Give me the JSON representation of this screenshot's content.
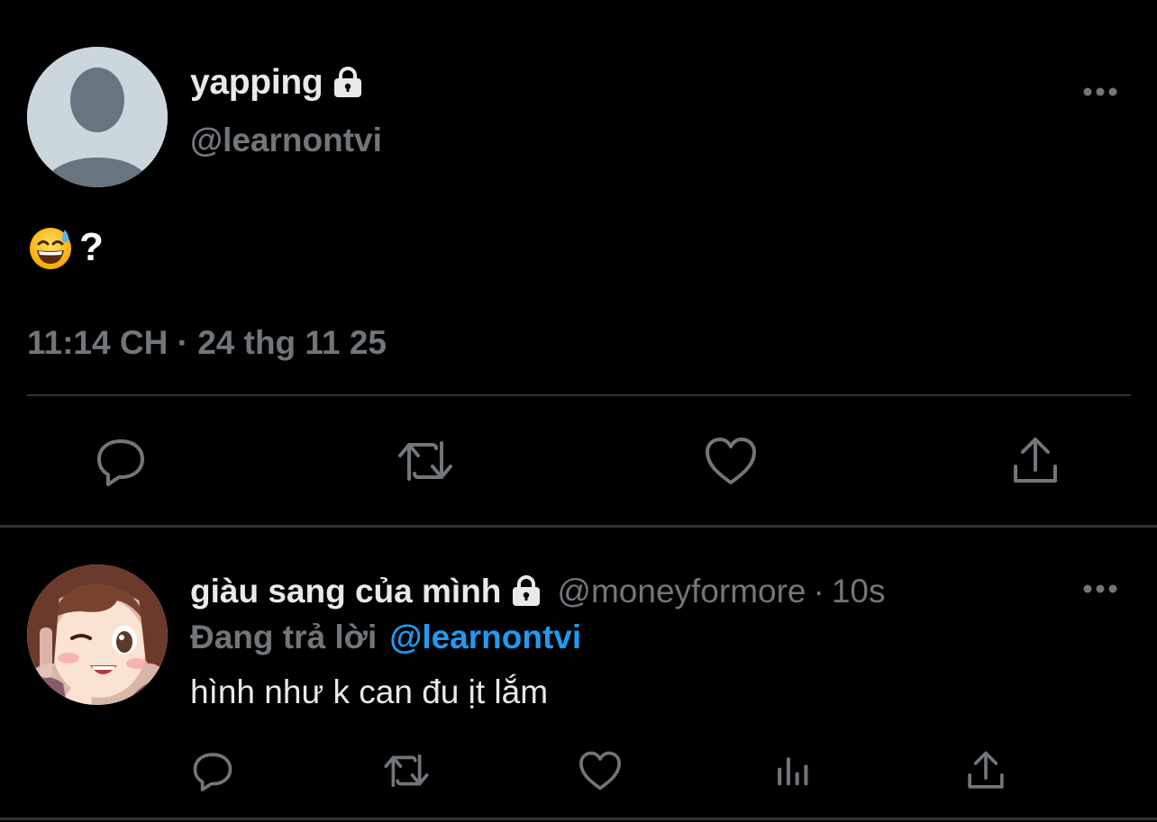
{
  "main_tweet": {
    "display_name": "yapping",
    "handle": "@learnontvi",
    "text": "?",
    "emoji": "grinning-face-with-sweat-icon",
    "timestamp": "11:14 CH · 24 thg 11 25",
    "actions": [
      "reply-icon",
      "retweet-icon",
      "like-icon",
      "share-icon"
    ]
  },
  "reply_tweet": {
    "display_name": "giàu sang của mình",
    "handle": "@moneyformore",
    "separator": "·",
    "time": "10s",
    "replying_label": "Đang trả lời",
    "replying_mention": "@learnontvi",
    "text": "hình như k can đu ịt lắm",
    "actions": [
      "reply-icon",
      "retweet-icon",
      "like-icon",
      "analytics-icon",
      "share-icon"
    ]
  },
  "colors": {
    "background": "#000000",
    "primary_text": "#e7e9ea",
    "secondary_text": "#71767b",
    "accent": "#1d9bf0",
    "divider": "#2f3336"
  }
}
